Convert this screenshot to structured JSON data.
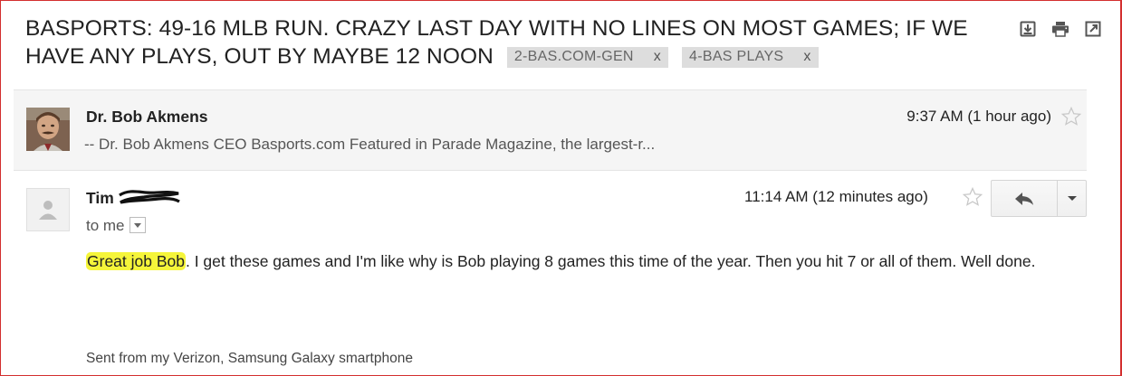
{
  "subject": {
    "text": "BASPORTS: 49-16 MLB RUN. CRAZY LAST DAY WITH NO LINES ON MOST GAMES; IF WE HAVE ANY PLAYS, OUT BY MAYBE 12 NOON",
    "labels": [
      {
        "name": "2-BAS.COM-GEN",
        "remove": "x"
      },
      {
        "name": "4-BAS PLAYS",
        "remove": "x"
      }
    ]
  },
  "toolbar_icons": [
    "download-icon",
    "print-icon",
    "new-window-icon"
  ],
  "messages": [
    {
      "sender": "Dr. Bob Akmens",
      "snippet": "-- Dr. Bob Akmens CEO Basports.com Featured in Parade Magazine, the largest-r...",
      "time": "9:37 AM (1 hour ago)"
    },
    {
      "sender": "Tim",
      "recipient": "to me",
      "time": "11:14 AM (12 minutes ago)",
      "body_highlight": "Great job Bob",
      "body_rest": ". I get these games and I'm like why is Bob playing 8 games this time of the year. Then you hit 7 or all of them. Well done.",
      "signature": "Sent from my Verizon, Samsung Galaxy smartphone"
    }
  ],
  "colors": {
    "highlight": "#f5f53a",
    "frame_border": "#d32f2f",
    "collapsed_bg": "#f5f5f5",
    "label_bg": "#dddddd"
  }
}
